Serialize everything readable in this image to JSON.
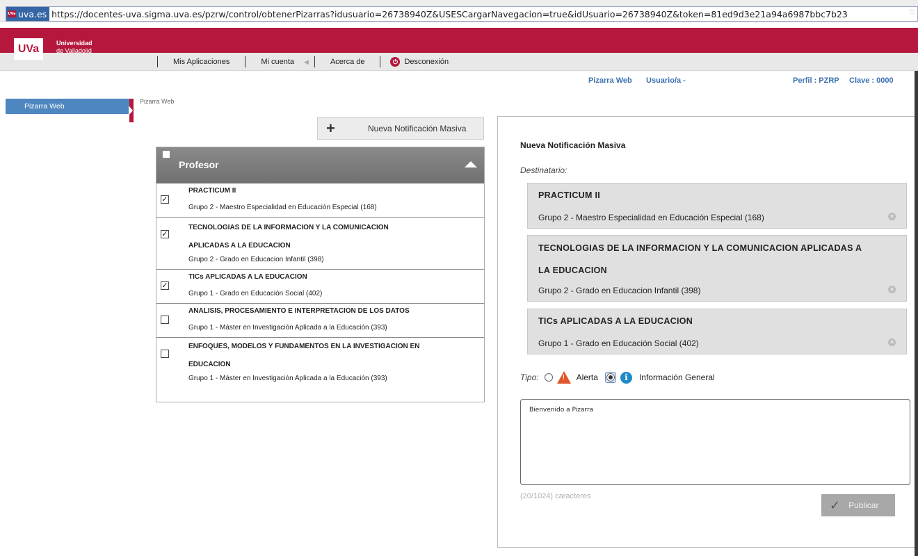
{
  "browser": {
    "site": "uva.es",
    "url": "https://docentes-uva.sigma.uva.es/pzrw/control/obtenerPizarras?idusuario=26738940Z&USESCargarNavegacion=true&idUsuario=26738940Z&token=81ed9d3e21a94a6987bbc7b23",
    "favicon_text": "UVa"
  },
  "header": {
    "logo": "UVa",
    "university_line1": "Universidad",
    "university_line2": "de Valladolid",
    "nav": [
      "Mis Aplicaciones",
      "Mi cuenta",
      "Acerca de",
      "Desconexión"
    ],
    "brand_color": "#b5183c"
  },
  "info": {
    "app": "Pizarra Web",
    "user": "Usuario/a -",
    "profile": "Perfil : PZRP",
    "key": "Clave : 0000"
  },
  "sidebar": {
    "items": [
      {
        "label": "Pizarra Web"
      }
    ]
  },
  "breadcrumb": "Pizarra Web",
  "new_button": {
    "label": "Nueva Notificación Masiva",
    "icon": "plus-icon"
  },
  "professor_panel": {
    "title": "Profesor",
    "courses": [
      {
        "name": "PRACTICUM II",
        "group": "Grupo 2 - Maestro Especialidad en Educación Especial (168)",
        "checked": true,
        "check_mark": "✓"
      },
      {
        "name_line1": "TECNOLOGIAS DE LA INFORMACION Y LA COMUNICACION",
        "name_line2": "APLICADAS A LA EDUCACION",
        "group": "Grupo 2 - Grado en Educacion Infantil (398)",
        "checked": true,
        "check_mark": "✓"
      },
      {
        "name": "TICs APLICADAS A LA EDUCACION",
        "group": "Grupo 1 - Grado en Educación Social (402)",
        "checked": true,
        "check_mark": "✓"
      },
      {
        "name": "ANALISIS, PROCESAMIENTO E INTERPRETACION DE LOS DATOS",
        "group": "Grupo 1 - Máster en Investigación Aplicada a la Educación (393)",
        "checked": false
      },
      {
        "name_line1": "ENFOQUES, MODELOS Y FUNDAMENTOS EN LA INVESTIGACION EN",
        "name_line2": "EDUCACION",
        "group": "Grupo 1 - Máster en Investigación Aplicada a la Educación (393)",
        "checked": false
      }
    ]
  },
  "notification": {
    "title": "Nueva Notificación Masiva",
    "recipient_label": "Destinatario:",
    "recipients": [
      {
        "name": "PRACTICUM II",
        "group": "Grupo 2 - Maestro Especialidad en Educación Especial (168)"
      },
      {
        "name_line1": "TECNOLOGIAS DE LA INFORMACION Y LA COMUNICACION APLICADAS A",
        "name_line2": "LA EDUCACION",
        "group": "Grupo 2 - Grado en Educacion Infantil (398)"
      },
      {
        "name": "TICs APLICADAS A LA EDUCACION",
        "group": "Grupo 1 - Grado en Educación Social (402)"
      }
    ],
    "type_label": "Tipo:",
    "type_options": [
      {
        "label": "Alerta",
        "checked": false,
        "icon": "warning-icon"
      },
      {
        "label": "Información General",
        "checked": true,
        "icon": "info-icon"
      }
    ],
    "message": "Bienvenido a Pizarra",
    "char_count": "(20/1024) caracteres",
    "publish_label": "Publicar"
  }
}
